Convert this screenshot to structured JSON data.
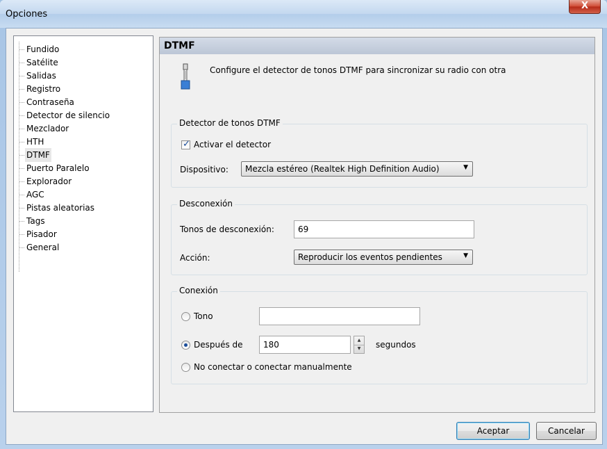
{
  "window": {
    "title": "Opciones",
    "close_glyph": "X"
  },
  "tree": {
    "items": [
      {
        "label": "Fundido"
      },
      {
        "label": "Satélite"
      },
      {
        "label": "Salidas"
      },
      {
        "label": "Registro"
      },
      {
        "label": "Contraseña"
      },
      {
        "label": "Detector de silencio"
      },
      {
        "label": "Mezclador"
      },
      {
        "label": "HTH"
      },
      {
        "label": "DTMF"
      },
      {
        "label": "Puerto Paralelo"
      },
      {
        "label": "Explorador"
      },
      {
        "label": "AGC"
      },
      {
        "label": "Pistas aleatorias"
      },
      {
        "label": "Tags"
      },
      {
        "label": "Pisador"
      },
      {
        "label": "General"
      }
    ],
    "selected": "DTMF"
  },
  "panel": {
    "title": "DTMF",
    "description": "Configure el detector de tonos DTMF para sincronizar su radio con otra",
    "icon": "connector-plug-icon"
  },
  "detector": {
    "legend": "Detector de tonos DTMF",
    "enable_label": "Activar el detector",
    "enable_checked": true,
    "device_label": "Dispositivo:",
    "device_value": "Mezcla estéreo (Realtek High Definition Audio)"
  },
  "disconnect": {
    "legend": "Desconexión",
    "tones_label": "Tonos de desconexión:",
    "tones_value": "69",
    "action_label": "Acción:",
    "action_value": "Reproducir los eventos pendientes"
  },
  "connect": {
    "legend": "Conexión",
    "tone_label": "Tono",
    "tone_value": "",
    "after_label": "Después de",
    "after_value": "180",
    "after_unit": "segundos",
    "manual_label": "No conectar o conectar manualmente",
    "selected": "after"
  },
  "buttons": {
    "ok": "Aceptar",
    "cancel": "Cancelar"
  },
  "colors": {
    "check_mark": "#1d4f9b",
    "radio_dot": "#1a4c99",
    "close_button": "#c8442f"
  }
}
